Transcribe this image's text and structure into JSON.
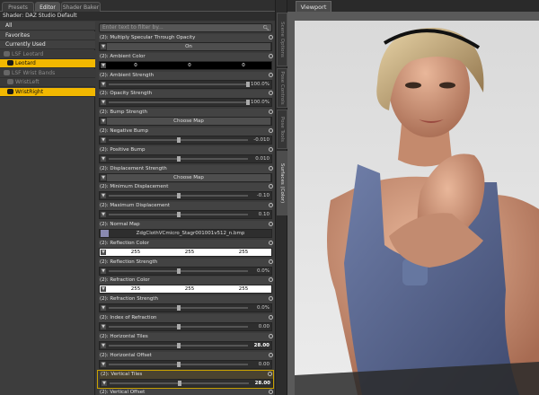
{
  "tabs": [
    "Presets",
    "Editor",
    "Shader Baker"
  ],
  "shader_label": "Shader: DAZ Studio Default",
  "left_items": [
    {
      "label": "All",
      "state": "normal"
    },
    {
      "label": "Favorites",
      "state": "normal"
    },
    {
      "label": "Currently Used",
      "state": "normal"
    },
    {
      "label": "LSF Leotard",
      "state": "dim"
    },
    {
      "label": "Leotard",
      "state": "sel"
    },
    {
      "label": "LSF Wrist Bands",
      "state": "dim"
    },
    {
      "label": "WristLeft",
      "state": "dim"
    },
    {
      "label": "WristRight",
      "state": "sel"
    }
  ],
  "filter_placeholder": "Enter text to filter by...",
  "properties": [
    {
      "label": "(2): Multiply Specular Through Opacity",
      "kind": "button",
      "value": "On"
    },
    {
      "label": "(2): Ambient Color",
      "kind": "rgb",
      "rgb": [
        "0",
        "0",
        "0"
      ],
      "dark": true
    },
    {
      "label": "(2): Ambient Strength",
      "kind": "slider",
      "value": "100.0%",
      "pos": 1.0
    },
    {
      "label": "(2): Opacity Strength",
      "kind": "slider",
      "value": "100.0%",
      "pos": 1.0
    },
    {
      "label": "(2): Bump Strength",
      "kind": "button",
      "value": "Choose Map"
    },
    {
      "label": "(2): Negative Bump",
      "kind": "slider",
      "value": "-0.010",
      "pos": 0.5
    },
    {
      "label": "(2): Positive Bump",
      "kind": "slider",
      "value": "0.010",
      "pos": 0.5
    },
    {
      "label": "(2): Displacement Strength",
      "kind": "button",
      "value": "Choose Map"
    },
    {
      "label": "(2): Minimum Displacement",
      "kind": "slider",
      "value": "-0.10",
      "pos": 0.5
    },
    {
      "label": "(2): Maximum Displacement",
      "kind": "slider",
      "value": "0.10",
      "pos": 0.5
    },
    {
      "label": "(2): Normal Map",
      "kind": "map",
      "value": "ZdgClothVCmicro_Stagr001001v512_n.bmp"
    },
    {
      "label": "(2): Reflection Color",
      "kind": "rgb",
      "rgb": [
        "255",
        "255",
        "255"
      ],
      "dark": false
    },
    {
      "label": "(2): Reflection Strength",
      "kind": "slider",
      "value": "0.0%",
      "pos": 0.5
    },
    {
      "label": "(2): Refraction Color",
      "kind": "rgb",
      "rgb": [
        "255",
        "255",
        "255"
      ],
      "dark": false
    },
    {
      "label": "(2): Refraction Strength",
      "kind": "slider",
      "value": "0.0%",
      "pos": 0.5
    },
    {
      "label": "(2): Index of Refraction",
      "kind": "slider",
      "value": "0.00",
      "pos": 0.5
    },
    {
      "label": "(2): Horizontal Tiles",
      "kind": "slider",
      "value": "28.00",
      "pos": 0.5,
      "bold": true
    },
    {
      "label": "(2): Horizontal Offset",
      "kind": "slider",
      "value": "0.00",
      "pos": 0.5
    },
    {
      "label": "(2): Vertical Tiles",
      "kind": "slider",
      "value": "28.00",
      "pos": 0.5,
      "bold": true,
      "highlight": true
    },
    {
      "label": "(2): Vertical Offset",
      "kind": "slider",
      "value": "",
      "pos": 0.5
    }
  ],
  "vertical_tabs": [
    "Scene Options",
    "Pose Controls",
    "Pose Tools",
    "Surfaces (Color)"
  ],
  "viewport_title": "Viewport"
}
